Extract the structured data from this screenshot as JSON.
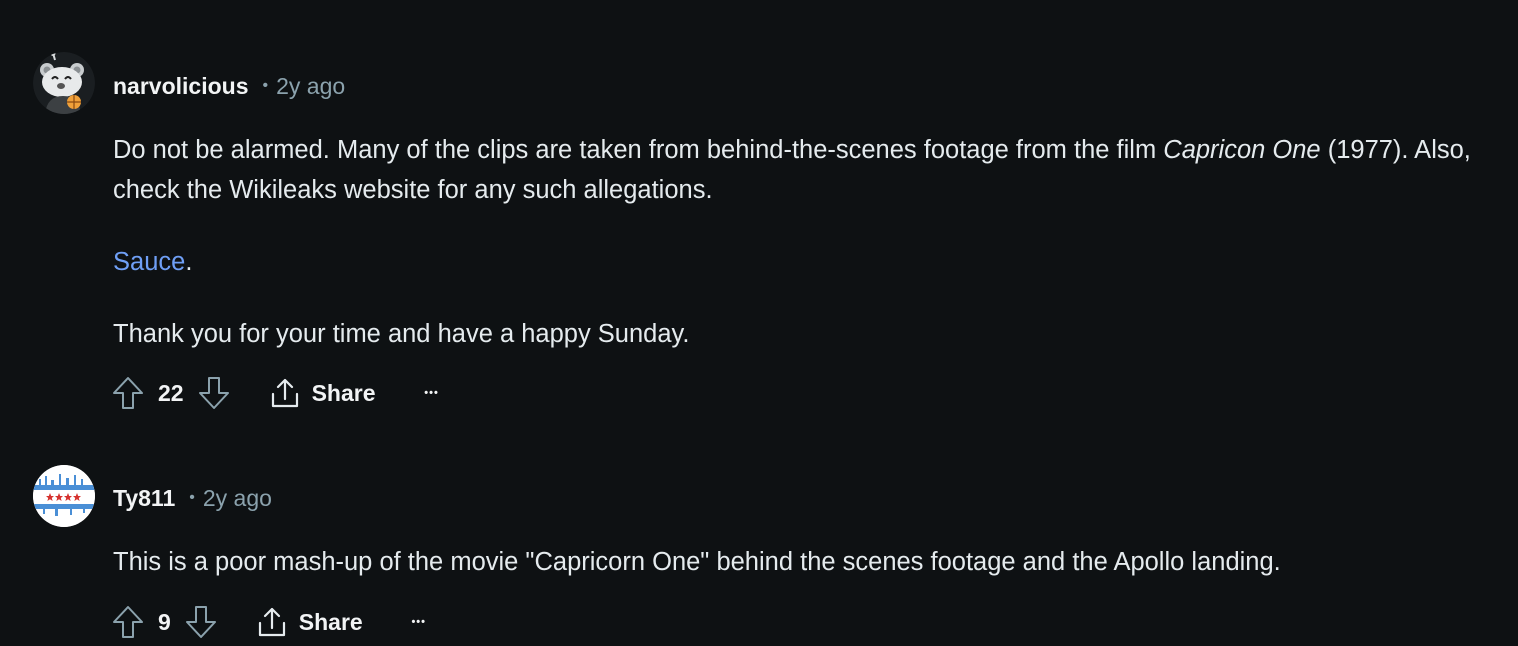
{
  "comments": [
    {
      "username": "narvolicious",
      "separator": "•",
      "time": "2y ago",
      "avatar_icon": "snoo-avatar-icon",
      "paragraph1_prefix": "Do not be alarmed. Many of the clips are taken from behind-the-scenes footage from the film ",
      "paragraph1_italic": "Capricon One",
      "paragraph1_suffix": " (1977). Also, check the Wikileaks website for any such allegations.",
      "link_text": "Sauce",
      "link_suffix": ".",
      "paragraph3": "Thank you for your time and have a happy Sunday.",
      "score": "22",
      "share_label": "Share",
      "more_label": "•••"
    },
    {
      "username": "Ty811",
      "separator": "•",
      "time": "2y ago",
      "avatar_icon": "chicago-flag-avatar-icon",
      "text": "This is a poor mash-up of the movie \"Capricorn One\" behind the scenes footage and the Apollo landing.",
      "score": "9",
      "share_label": "Share",
      "more_label": "•••"
    }
  ],
  "colors": {
    "background": "#0e1113",
    "text": "#e5ebee",
    "muted": "#8ba2ad",
    "link": "#6f9ff5"
  }
}
